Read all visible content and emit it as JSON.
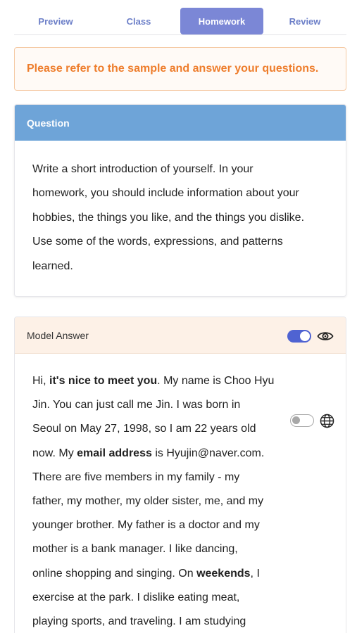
{
  "tabs": [
    {
      "label": "Preview",
      "active": false
    },
    {
      "label": "Class",
      "active": false
    },
    {
      "label": "Homework",
      "active": true
    },
    {
      "label": "Review",
      "active": false
    }
  ],
  "notice": {
    "text": "Please refer to the sample and answer your questions."
  },
  "question": {
    "header": "Question",
    "lines": [
      "Write a short introduction of yourself. In your",
      "homework, you should include information about your",
      "hobbies, the things you like, and the things you dislike.",
      "Use some of the words, expressions, and patterns",
      "learned."
    ]
  },
  "model_answer": {
    "header": "Model Answer",
    "show_toggle_on": true,
    "translate_toggle_on": false,
    "lines": [
      {
        "a": "Hi, ",
        "b": "it's nice to meet you",
        "c": ". My name is Choo Hyu"
      },
      {
        "a": "Jin. You can just call me Jin. I was born in",
        "b": "",
        "c": ""
      },
      {
        "a": "Seoul on May 27, 1998, so I am 22 years old",
        "b": "",
        "c": ""
      },
      {
        "a": "now. My ",
        "b": "email address",
        "c": " is Hyujin@naver.com."
      },
      {
        "a": "There are five members in my family - my",
        "b": "",
        "c": ""
      },
      {
        "a": "father, my mother, my older sister, me, and my",
        "b": "",
        "c": ""
      },
      {
        "a": "younger brother. My father is a doctor and my",
        "b": "",
        "c": ""
      },
      {
        "a": "mother is a bank manager. I like dancing,",
        "b": "",
        "c": ""
      },
      {
        "a": "online shopping and singing. On ",
        "b": "weekends",
        "c": ", I"
      },
      {
        "a": "exercise at the park. I dislike eating meat,",
        "b": "",
        "c": ""
      },
      {
        "a": "playing sports, and traveling. I am studying",
        "b": "",
        "c": ""
      }
    ]
  },
  "colors": {
    "accent": "#7b87d6",
    "notice": "#ee7d2c",
    "question_header": "#6ea4d8",
    "model_header_bg": "#fdf1e7",
    "toggle_on": "#4f63d2"
  },
  "icons": [
    "eye-icon",
    "globe-icon"
  ]
}
